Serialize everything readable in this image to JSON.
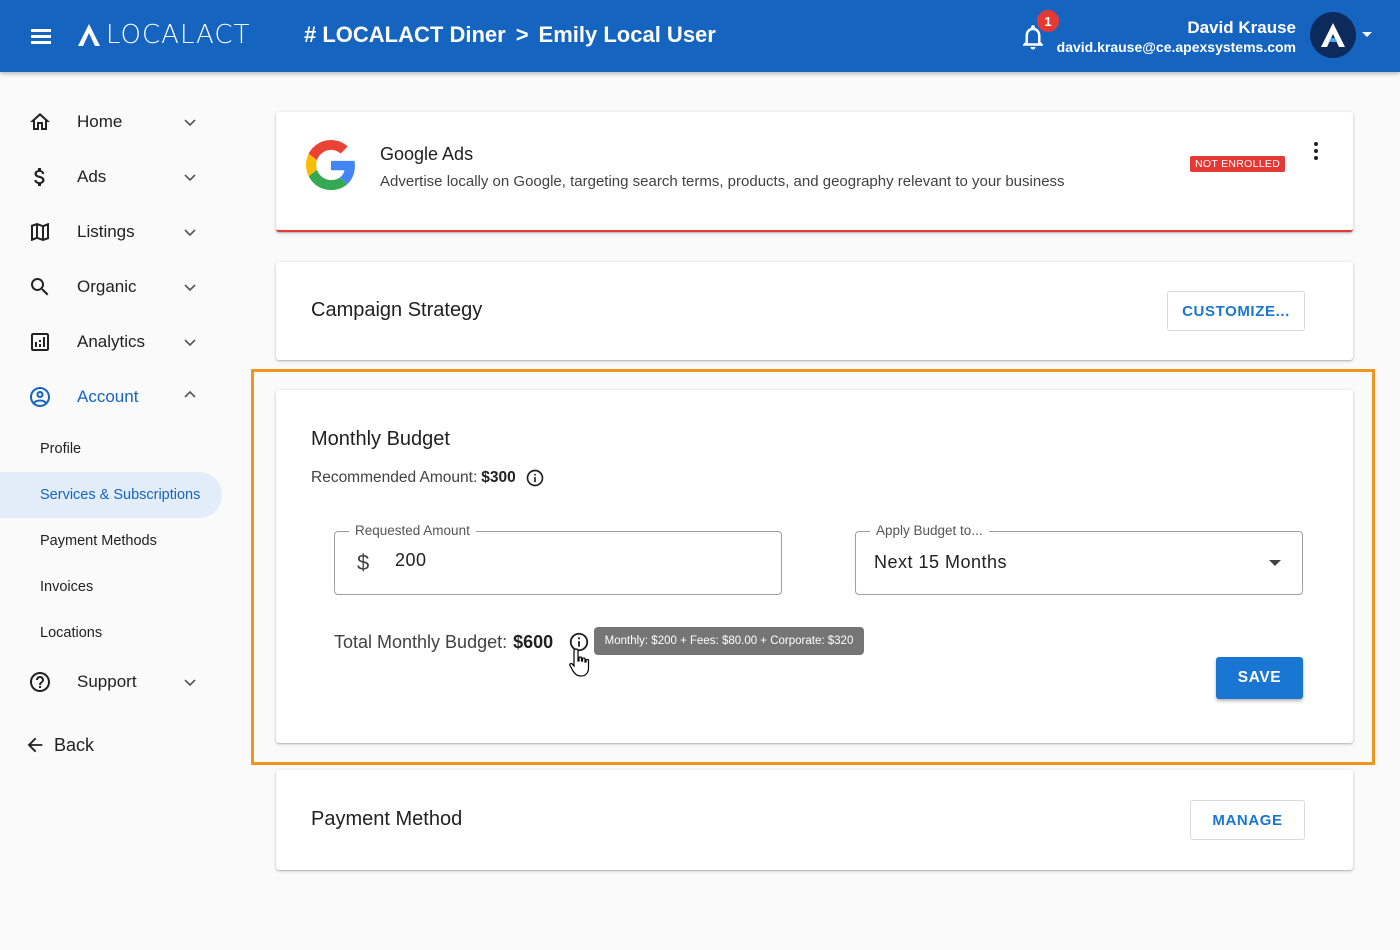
{
  "header": {
    "logo_text": "LOCALACT",
    "crumb_business": "# LOCALACT Diner",
    "crumb_separator": ">",
    "crumb_user": "Emily Local User",
    "notification_count": "1",
    "user_name": "David Krause",
    "user_email": "david.krause@ce.apexsystems.com"
  },
  "sidebar": {
    "items": [
      {
        "label": "Home",
        "icon": "home-icon"
      },
      {
        "label": "Ads",
        "icon": "dollar-icon"
      },
      {
        "label": "Listings",
        "icon": "map-icon"
      },
      {
        "label": "Organic",
        "icon": "search-icon"
      },
      {
        "label": "Analytics",
        "icon": "analytics-icon"
      },
      {
        "label": "Account",
        "icon": "account-circle-icon"
      }
    ],
    "account_sub": [
      {
        "label": "Profile"
      },
      {
        "label": "Services & Subscriptions"
      },
      {
        "label": "Payment Methods"
      },
      {
        "label": "Invoices"
      },
      {
        "label": "Locations"
      }
    ],
    "support_label": "Support",
    "back_label": "Back"
  },
  "ads_card": {
    "title": "Google Ads",
    "description": "Advertise locally on Google, targeting search terms, products, and geography relevant to your business",
    "status": "NOT ENROLLED"
  },
  "strategy_card": {
    "title": "Campaign Strategy",
    "button": "CUSTOMIZE..."
  },
  "budget_card": {
    "title": "Monthly Budget",
    "recommended_label": "Recommended Amount:",
    "recommended_value": "$300",
    "requested_label": "Requested Amount",
    "currency_symbol": "$",
    "requested_value": "200",
    "apply_label": "Apply Budget to...",
    "apply_value": "Next 15 Months",
    "total_label": "Total Monthly Budget:",
    "total_value": "$600",
    "tooltip": "Monthly: $200 + Fees: $80.00 + Corporate: $320",
    "save_button": "SAVE"
  },
  "payment_card": {
    "title": "Payment Method",
    "button": "MANAGE"
  },
  "colors": {
    "primary": "#1565c0",
    "accent_button": "#1976d2",
    "error": "#e53935",
    "highlight": "#f0961e"
  }
}
